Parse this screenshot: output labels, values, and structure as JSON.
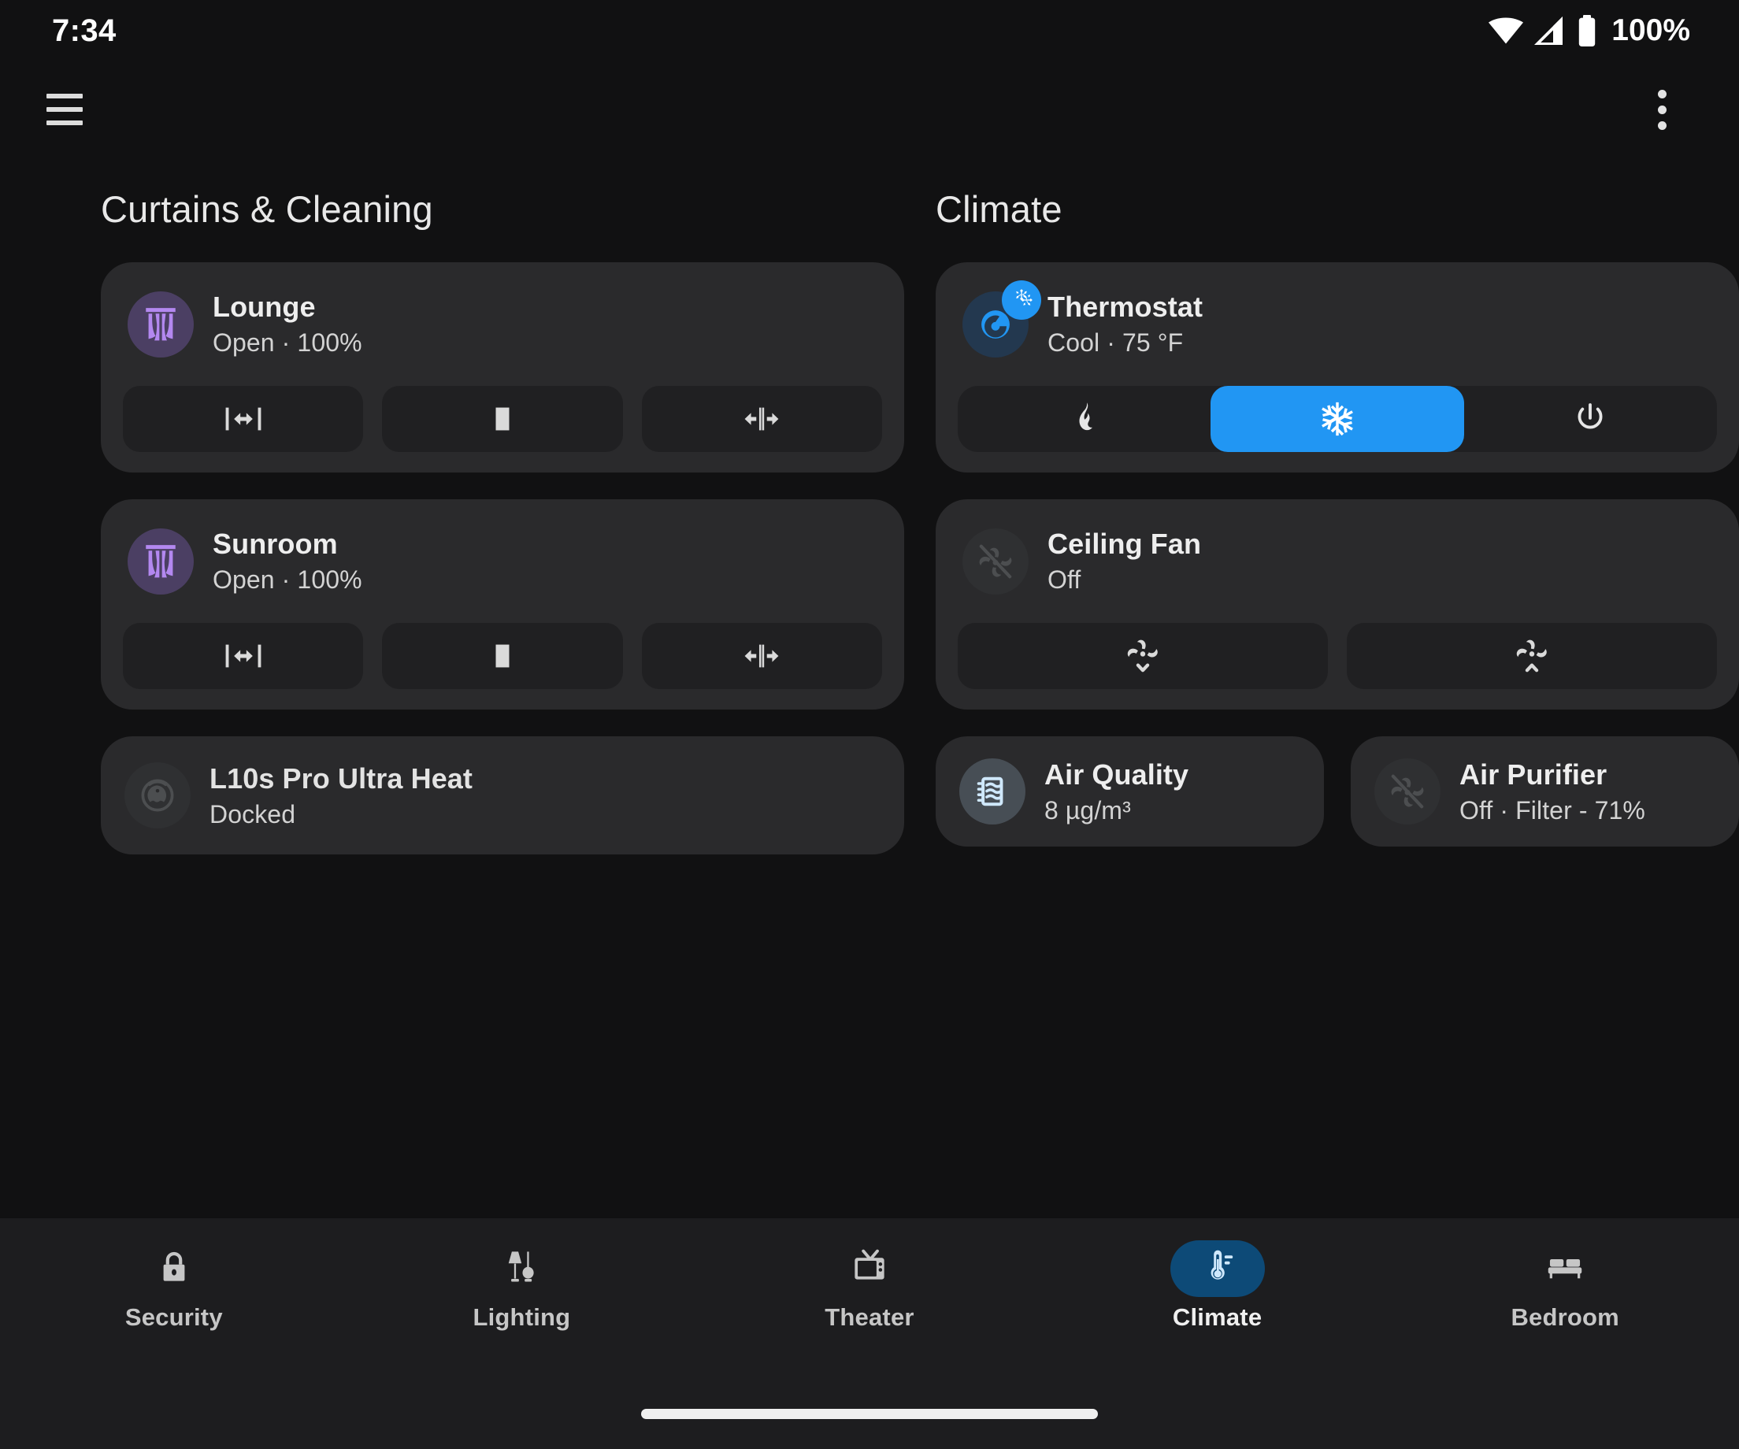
{
  "status_bar": {
    "time": "7:34",
    "battery_percent": "100%",
    "icons": [
      "wifi-icon",
      "cellular-signal-icon",
      "battery-icon"
    ]
  },
  "app_bar": {
    "menu_icon": "hamburger-menu-icon",
    "overflow_icon": "overflow-menu-icon"
  },
  "sections": [
    {
      "id": "curtains",
      "title": "Curtains & Cleaning"
    },
    {
      "id": "climate",
      "title": "Climate"
    }
  ],
  "curtains_section": {
    "cards": [
      {
        "name": "Lounge",
        "state": "Open · 100%",
        "icon": "curtains-icon",
        "icon_color": "#b388f0",
        "avatar_color": "#4b3f63",
        "controls": [
          {
            "label": "open-cover",
            "icon": "cover-open-icon"
          },
          {
            "label": "stop-cover",
            "icon": "cover-stop-icon"
          },
          {
            "label": "close-cover",
            "icon": "cover-close-icon"
          }
        ]
      },
      {
        "name": "Sunroom",
        "state": "Open · 100%",
        "icon": "curtains-icon",
        "icon_color": "#b388f0",
        "avatar_color": "#4b3f63",
        "controls": [
          {
            "label": "open-cover",
            "icon": "cover-open-icon"
          },
          {
            "label": "stop-cover",
            "icon": "cover-stop-icon"
          },
          {
            "label": "close-cover",
            "icon": "cover-close-icon"
          }
        ]
      }
    ],
    "vacuum": {
      "name": "L10s Pro Ultra Heat",
      "state": "Docked",
      "icon": "robot-vacuum-icon",
      "icon_color": "#4c4e50"
    }
  },
  "climate_section": {
    "thermostat": {
      "name": "Thermostat",
      "state": "Cool · 75 °F",
      "icon": "thermostat-dial-icon",
      "badge_icon": "snowflake-icon",
      "accent_color": "#2196f3",
      "modes": [
        {
          "label": "heat",
          "icon": "flame-icon",
          "active": false
        },
        {
          "label": "cool",
          "icon": "snowflake-icon",
          "active": true
        },
        {
          "label": "off",
          "icon": "power-icon",
          "active": false
        }
      ]
    },
    "ceiling_fan": {
      "name": "Ceiling Fan",
      "state": "Off",
      "icon": "fan-off-icon",
      "controls": [
        {
          "label": "fan-speed-down",
          "icon": "fan-speed-down-icon"
        },
        {
          "label": "fan-speed-up",
          "icon": "fan-speed-up-icon"
        }
      ]
    },
    "air_quality": {
      "name": "Air Quality",
      "state": "8 µg/m³",
      "icon": "air-filter-icon",
      "icon_color": "#cfe8fc"
    },
    "air_purifier": {
      "name": "Air Purifier",
      "state": "Off · Filter - 71%",
      "icon": "fan-off-icon",
      "icon_color": "#4c4e50"
    }
  },
  "bottom_nav": {
    "items": [
      {
        "label": "Security",
        "icon": "lock-icon",
        "active": false
      },
      {
        "label": "Lighting",
        "icon": "lamps-icon",
        "active": false
      },
      {
        "label": "Theater",
        "icon": "tv-retro-icon",
        "active": false
      },
      {
        "label": "Climate",
        "icon": "thermometer-icon",
        "active": true
      },
      {
        "label": "Bedroom",
        "icon": "bed-icon",
        "active": false
      }
    ],
    "active_pill_color": "#0d4a77"
  }
}
